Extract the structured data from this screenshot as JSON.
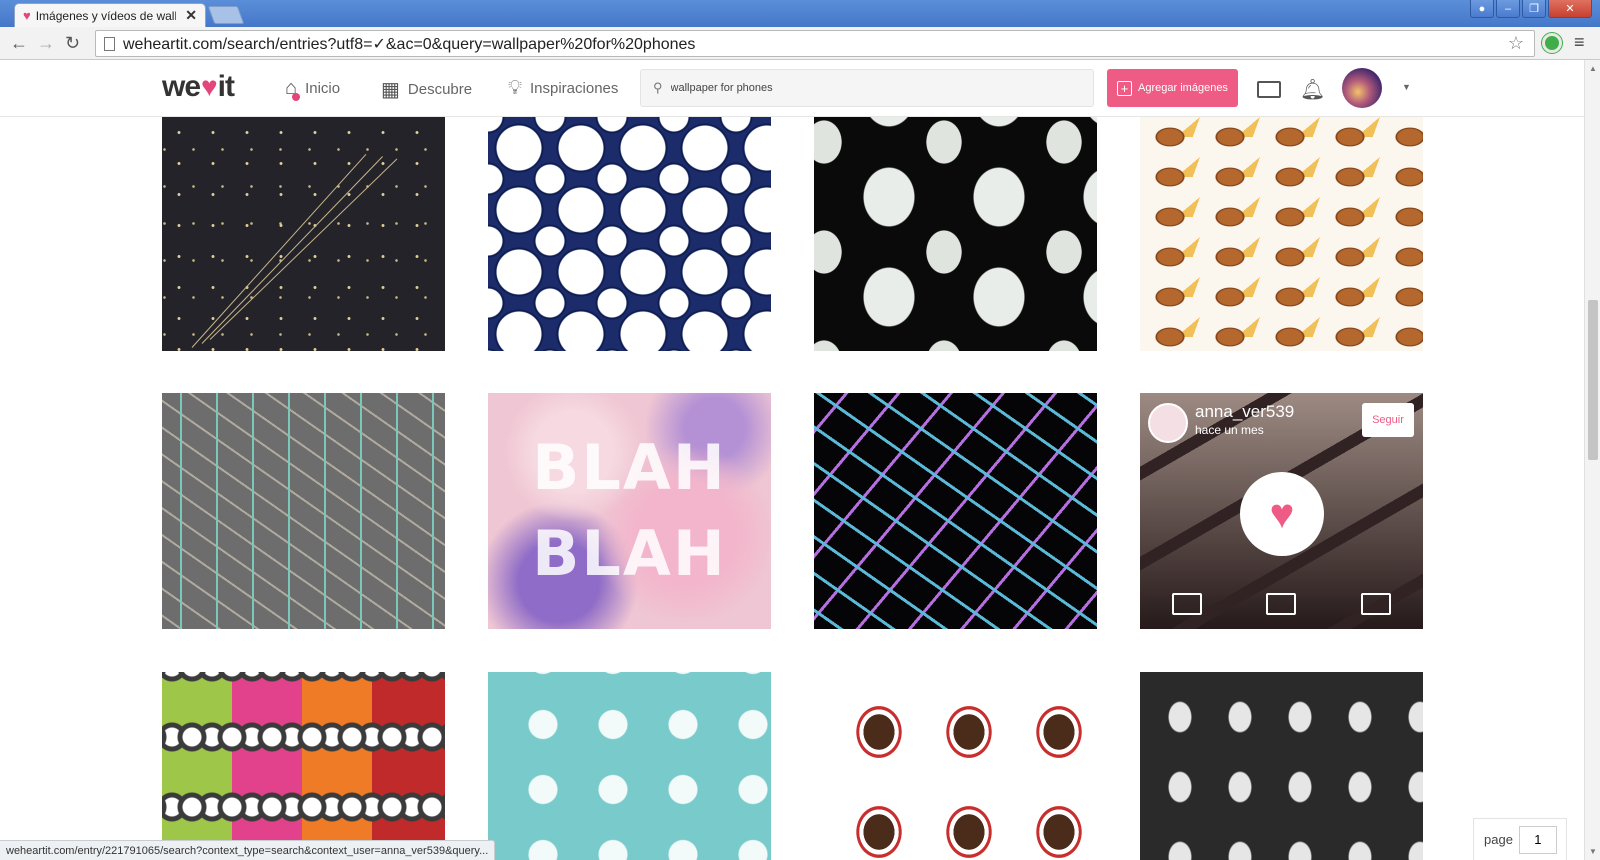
{
  "browser": {
    "tab_title": "Imágenes y vídeos de wall",
    "tab_close": "✕",
    "url": "weheartit.com/search/entries?utf8=✓&ac=0&query=wallpaper%20for%20phones",
    "status_url": "weheartit.com/entry/221791065/search?context_type=search&context_user=anna_ver539&query..."
  },
  "header": {
    "logo_left": "we",
    "logo_right": "it",
    "nav": [
      {
        "label": "Inicio",
        "icon": "home-icon"
      },
      {
        "label": "Descubre",
        "icon": "grid-icon"
      },
      {
        "label": "Inspiraciones",
        "icon": "lightbulb-icon"
      }
    ],
    "search_value": "wallpaper for phones",
    "add_images_label": "Agregar imágenes"
  },
  "grid": {
    "hover_card": {
      "username": "anna_ver539",
      "time": "hace un mes",
      "follow_label": "Seguir"
    },
    "blah_lines": [
      "BLAH",
      "BLAH"
    ]
  },
  "pager": {
    "label": "page",
    "value": "1"
  },
  "colors": {
    "brand_pink": "#ee5b84",
    "chrome_blue": "#4a7bcf"
  }
}
